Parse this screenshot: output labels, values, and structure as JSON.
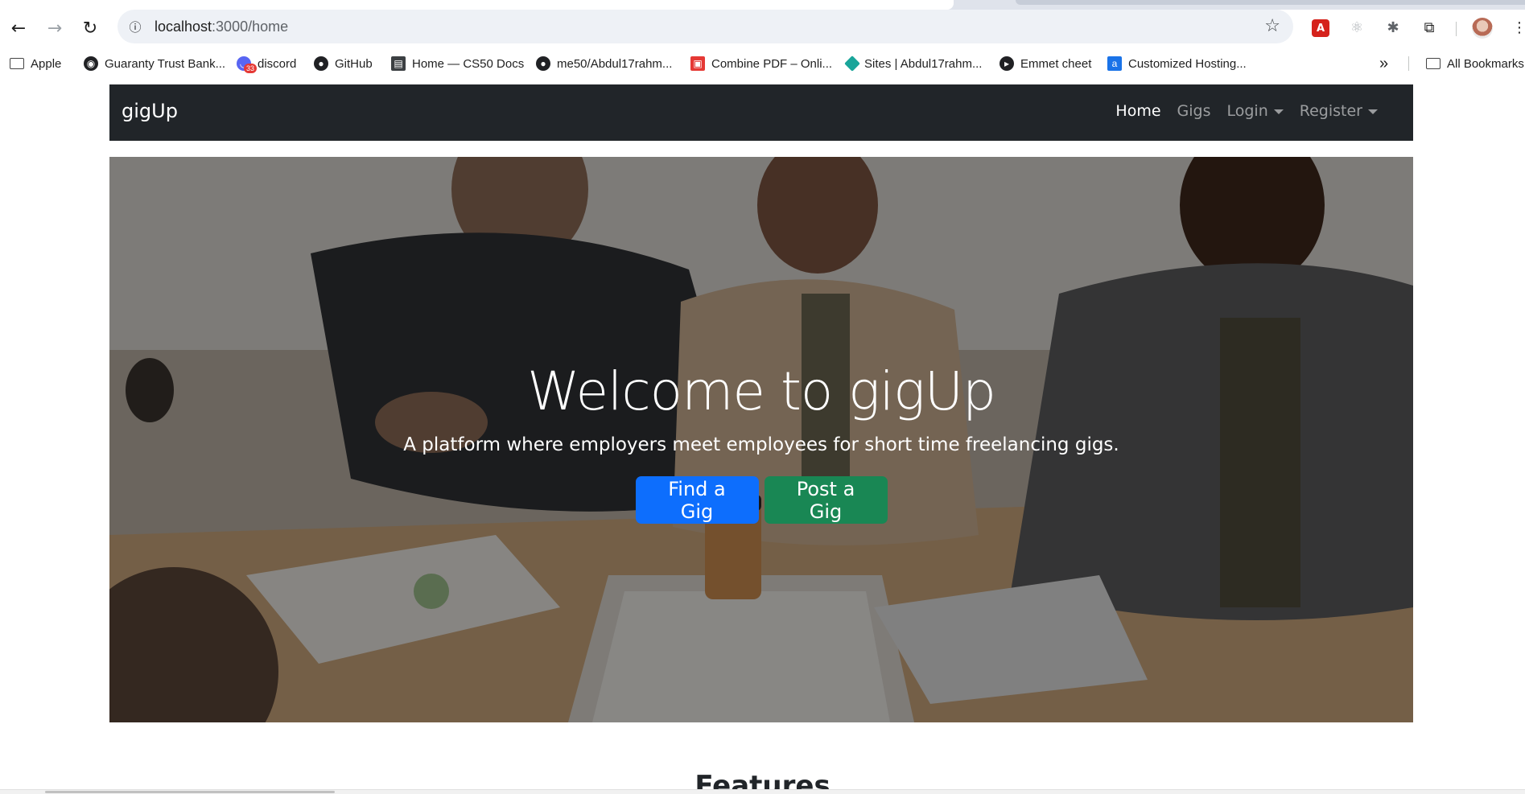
{
  "browser": {
    "url_host": "localhost",
    "url_path": ":3000/home",
    "bookmarks": [
      {
        "label": "Apple",
        "icon": "folder-icon"
      },
      {
        "label": "Guaranty Trust Bank...",
        "icon": "bank-icon"
      },
      {
        "label": "discord",
        "icon": "discord-icon",
        "badge": "33"
      },
      {
        "label": "GitHub",
        "icon": "github-icon"
      },
      {
        "label": "Home — CS50 Docs",
        "icon": "docs-icon"
      },
      {
        "label": "me50/Abdul17rahm...",
        "icon": "github-icon"
      },
      {
        "label": "Combine PDF – Onli...",
        "icon": "pdf-icon"
      },
      {
        "label": "Sites | Abdul17rahm...",
        "icon": "sites-icon"
      },
      {
        "label": "Emmet cheet",
        "icon": "emmet-icon"
      },
      {
        "label": "Customized Hosting...",
        "icon": "hosting-icon"
      }
    ],
    "all_bookmarks_label": "All Bookmarks"
  },
  "navbar": {
    "brand": "gigUp",
    "links": [
      {
        "label": "Home",
        "active": true
      },
      {
        "label": "Gigs",
        "active": false
      },
      {
        "label": "Login",
        "dropdown": true
      },
      {
        "label": "Register",
        "dropdown": true
      }
    ]
  },
  "hero": {
    "title": "Welcome to gigUp",
    "subtitle": "A platform where employers meet employees for short time freelancing gigs.",
    "primary_button": "Find a Gig",
    "secondary_button": "Post a Gig"
  },
  "sections": {
    "features_heading": "Features"
  },
  "colors": {
    "navbar_bg": "#212529",
    "primary": "#0d6efd",
    "success": "#198754"
  }
}
